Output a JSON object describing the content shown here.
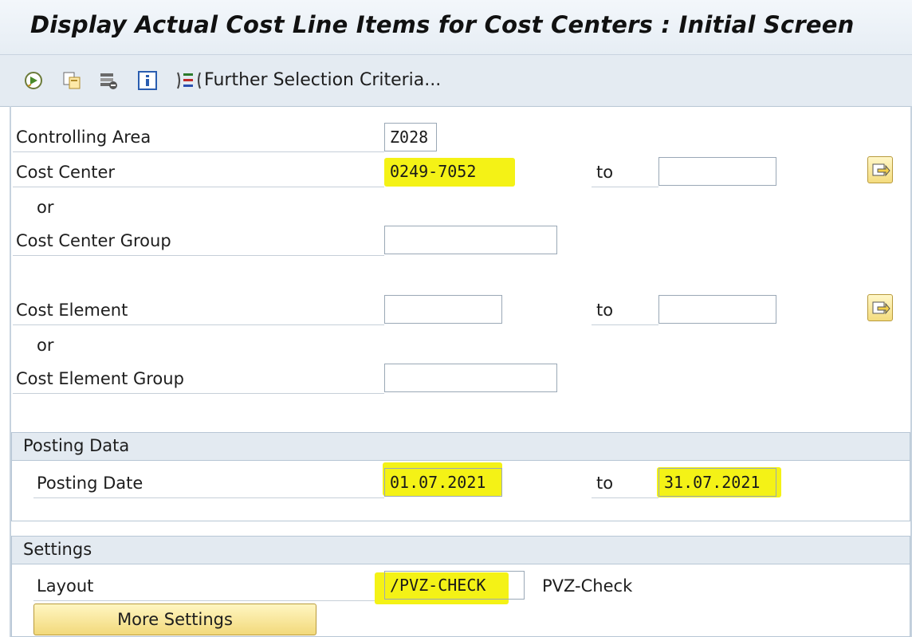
{
  "title": "Display Actual Cost Line Items for Cost Centers : Initial Screen",
  "toolbar": {
    "icons": [
      "execute-icon",
      "copy-icon",
      "delete-variant-icon",
      "info-icon",
      "further-selection-icon"
    ],
    "further_selection_label": "Further Selection Criteria..."
  },
  "form": {
    "controlling_area": {
      "label": "Controlling Area",
      "value": "Z028"
    },
    "cost_center": {
      "label": "Cost Center",
      "from": "0249-7052",
      "to_label": "to",
      "to": ""
    },
    "or1": "or",
    "cost_center_group": {
      "label": "Cost Center Group",
      "value": ""
    },
    "cost_element": {
      "label": "Cost Element",
      "from": "",
      "to_label": "to",
      "to": ""
    },
    "or2": "or",
    "cost_element_group": {
      "label": "Cost Element Group",
      "value": ""
    }
  },
  "posting_data": {
    "title": "Posting Data",
    "posting_date": {
      "label": "Posting Date",
      "from": "01.07.2021",
      "to_label": "to",
      "to": "31.07.2021"
    }
  },
  "settings": {
    "title": "Settings",
    "layout": {
      "label": "Layout",
      "value": "/PVZ-CHECK",
      "description": "PVZ-Check"
    },
    "more_settings_label": "More Settings"
  },
  "colors": {
    "highlight": "#f4f216",
    "header_bg": "#e4ebf2"
  }
}
